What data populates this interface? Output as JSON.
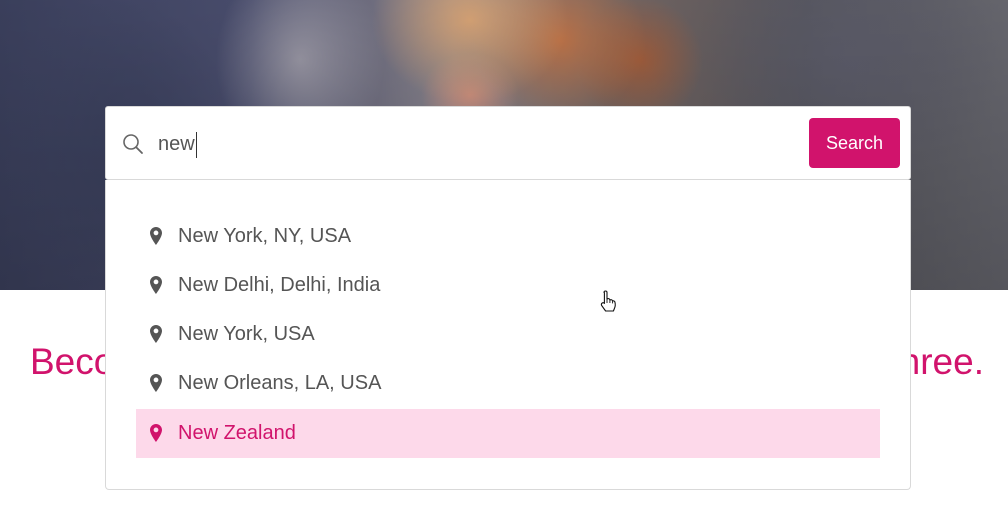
{
  "hero": {
    "headline_left": "Beco",
    "headline_right": "nree."
  },
  "search": {
    "value": "new",
    "button_label": "Search",
    "icon": "search-icon"
  },
  "suggestions": [
    {
      "label": "New York, NY, USA",
      "icon": "map-pin-icon",
      "active": false
    },
    {
      "label": "New Delhi, Delhi, India",
      "icon": "map-pin-icon",
      "active": false
    },
    {
      "label": "New York, USA",
      "icon": "map-pin-icon",
      "active": false
    },
    {
      "label": "New Orleans, LA, USA",
      "icon": "map-pin-icon",
      "active": false
    },
    {
      "label": "New Zealand",
      "icon": "map-pin-icon",
      "active": true
    }
  ],
  "colors": {
    "accent": "#d1136c",
    "active_bg": "#fdd9ea",
    "text": "#555555"
  }
}
